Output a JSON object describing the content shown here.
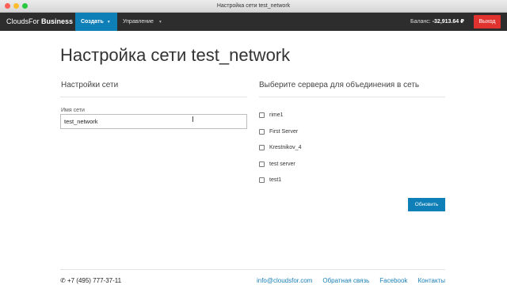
{
  "window": {
    "title": "Настройка сети test_network"
  },
  "navbar": {
    "brand_light": "CloudsFor",
    "brand_bold": "Business",
    "create_label": "Создать",
    "manage_label": "Управление",
    "balance_label": "Баланс:",
    "balance_value": "-32,913.64 ₽",
    "logout_label": "Выход"
  },
  "page": {
    "title": "Настройка сети test_network",
    "left_section_title": "Настройки сети",
    "name_label": "Имя сети",
    "name_value": "test_network",
    "right_section_title": "Выберите сервера для объединения в сеть",
    "servers": [
      "rime1",
      "First Server",
      "Krestnikov_4",
      "test server",
      "test1"
    ],
    "update_button": "Обновить"
  },
  "footer": {
    "phone": "+7 (495) 777-37-11",
    "email": "info@cloudsfor.com",
    "feedback": "Обратная связь",
    "facebook": "Facebook",
    "contacts": "Контакты"
  },
  "colors": {
    "accent": "#0e7fb7",
    "danger": "#e0322e",
    "navbar": "#2d2d2d"
  }
}
